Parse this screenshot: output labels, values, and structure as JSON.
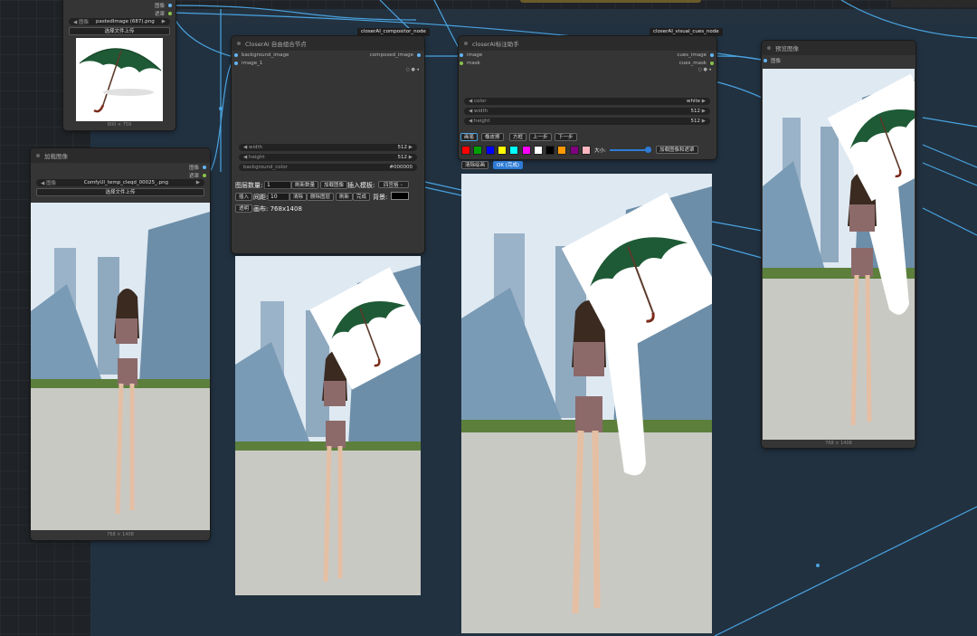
{
  "colors": {
    "canvas": "#1f2327",
    "group": "#213140",
    "node_body": "#353535",
    "node_title": "#2b2b2b",
    "wire": "#4aa3e0",
    "accent_blue": "#2e7bd6"
  },
  "badges": {
    "compositor": "closerAI_compositor_node",
    "visual_cues": "closerAI_visual_cues_node"
  },
  "node_load_top": {
    "out_image": "图像",
    "out_mask": "遮罩",
    "file_label": "图像",
    "file_value": "pastedImage (687).png",
    "upload_button": "选择文件上传",
    "size": "800 × 759"
  },
  "node_load_left": {
    "title": "加载图像",
    "out_image": "图像",
    "out_mask": "遮罩",
    "file_label": "图像",
    "file_value": "ComfyUI_temp_cleqd_00025_.png",
    "upload_button": "选择文件上传",
    "size": "768 × 1408"
  },
  "node_compositor": {
    "title": "CloserAI 自由组合节点",
    "in_bg": "background_image",
    "in_img1": "image_1",
    "out": "composed_image",
    "width_label": "width",
    "width_value": "512",
    "height_label": "height",
    "height_value": "512",
    "bgcolor_label": "background_color",
    "bgcolor_value": "#000000",
    "layer_count_label": "图层数量:",
    "layer_count_value": "1",
    "refresh_count": "刷新数量",
    "load_image": "加载图像",
    "template_label": "插入模板:",
    "template_value": "四宫格",
    "insert": "插入",
    "gap_label": "间距:",
    "gap_value": "10",
    "clear": "清除",
    "delete_layer": "删除图层",
    "refresh": "刷新",
    "done": "完成",
    "bg_label": "背景:",
    "transparent": "透明",
    "canvas_label": "画布: 768x1408"
  },
  "node_cues": {
    "title": "closerAI标注助手",
    "in_image": "image",
    "in_mask": "mask",
    "out_image": "cues_image",
    "out_mask": "cues_mask",
    "color_label": "color",
    "color_value": "white",
    "width_label": "width",
    "width_value": "512",
    "height_label": "height",
    "height_value": "512",
    "tool_brush": "画笔",
    "tool_eraser": "橡皮擦",
    "tool_rect": "方框",
    "undo": "上一步",
    "redo": "下一步",
    "size_label": "大小:",
    "load_btn": "加载图像和遮罩",
    "clear_btn": "清除绘画",
    "ok_btn": "OK (完成)",
    "swatches": [
      "#ff0000",
      "#00a000",
      "#0000ff",
      "#ffff00",
      "#00ffff",
      "#ff00ff",
      "#ffffff",
      "#000000",
      "#ff9900",
      "#800080",
      "#ffb6c1"
    ]
  },
  "node_preview": {
    "title": "预览图像",
    "in_image": "图像",
    "size": "768 × 1408"
  }
}
